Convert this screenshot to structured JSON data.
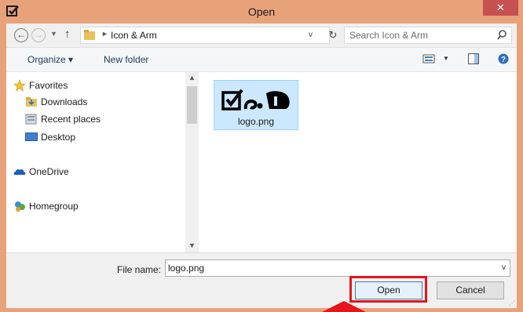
{
  "window": {
    "title": "Open",
    "close_label": "✕"
  },
  "address": {
    "path": "Icon & Arm",
    "search_placeholder": "Search Icon & Arm"
  },
  "toolbar": {
    "organize_label": "Organize ▾",
    "new_folder_label": "New folder"
  },
  "navigation": {
    "items": [
      {
        "label": "Favorites",
        "icon": "star-icon"
      },
      {
        "label": "Downloads",
        "icon": "downloads-folder-icon"
      },
      {
        "label": "Recent places",
        "icon": "recent-places-icon"
      },
      {
        "label": "Desktop",
        "icon": "desktop-icon"
      },
      {
        "label": "OneDrive",
        "icon": "onedrive-icon"
      },
      {
        "label": "Homegroup",
        "icon": "homegroup-icon"
      }
    ]
  },
  "files": [
    {
      "name": "logo.png",
      "selected": true
    }
  ],
  "bottom": {
    "file_name_label": "File name:",
    "file_name_value": "logo.png",
    "open_label": "Open",
    "cancel_label": "Cancel"
  },
  "colors": {
    "frame": "#e8a27a",
    "close": "#c75050",
    "selection": "#cce8ff",
    "highlight": "#e8141b"
  }
}
